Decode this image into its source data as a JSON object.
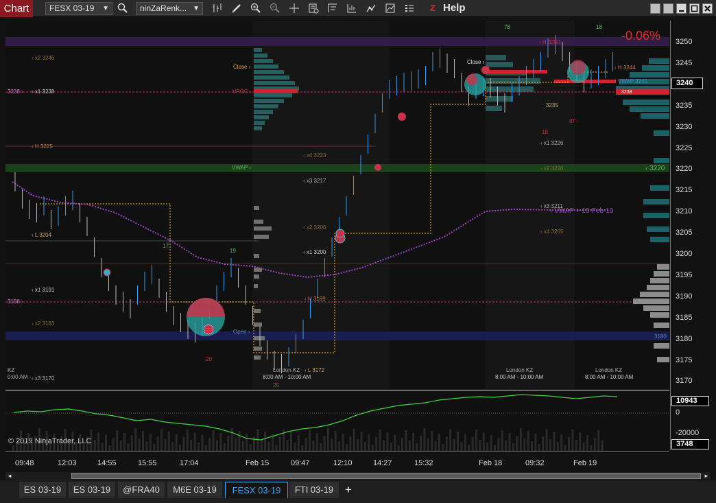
{
  "toolbar": {
    "chart_tab": "Chart",
    "instrument": "FESX 03-19",
    "bar_type": "ninZaRenk...",
    "help": "Help",
    "z_logo": "Z",
    "icons": [
      "search-icon",
      "bar-type-icon",
      "draw-icon",
      "zoom-in-icon",
      "zoom-out-icon",
      "crosshair-icon",
      "data-box-icon",
      "templates-icon",
      "chart-trader-icon",
      "strategy-icon",
      "indicators-icon",
      "properties-icon"
    ]
  },
  "window_controls": [
    "restore-icon",
    "tile-icon",
    "minimize-icon",
    "maximize-icon",
    "close-icon"
  ],
  "chart": {
    "percent_change": "-0.06%",
    "copyright": "© 2019 NinjaTrader, LLC",
    "price_axis": [
      "3250",
      "3245",
      "3240",
      "3235",
      "3230",
      "3225",
      "3220",
      "3215",
      "3210",
      "3205",
      "3200",
      "3195",
      "3190",
      "3185",
      "3180",
      "3175",
      "3170"
    ],
    "current_price": "3240",
    "sub_axis": [
      "0",
      "-20000"
    ],
    "sub_current": "10943",
    "sub_bottom": "3748",
    "time_axis": [
      "09:48",
      "12:03",
      "14:55",
      "15:55",
      "17:04",
      "Feb 15",
      "09:47",
      "12:10",
      "14:27",
      "15:32",
      "Feb 18",
      "09:32",
      "Feb 19"
    ],
    "annotations": {
      "x2_3246": "‹ x2 3246",
      "l3238": "3238 ›",
      "x1_3238": "‹ x1 3238",
      "h3225": "‹ H 3225",
      "l3204": "‹ L 3204",
      "l3188": "3188 ›",
      "x1_3191": "‹ x1 3191",
      "x2_3183": "‹ x2 3183",
      "x3_3170": "‹ x3 3170",
      "kz_left": "KZ",
      "am_left": "0:00 AM -",
      "close1": "Close ›",
      "vpoc": "VPOC ›",
      "vwap": "VWAP ›",
      "open": "Open ›",
      "x4_3223": "‹ x4 3223",
      "x3_3217": "‹ x3 3217",
      "x2_3206": "‹ x2 3206",
      "x1_3200": "‹ x1 3200",
      "h3189": "‹ H 3189",
      "l3172": "‹ L 3172",
      "london1": "London KZ",
      "time1": "8:00 AM - 10:00 AM",
      "close2": "Close ›",
      "h3250": "‹ H 3250",
      "h3244": "‹ H 3244",
      "x1_3226": "‹ x1 3226",
      "x2_3220": "‹ x2 3220",
      "x3_3211": "‹ x3 3211",
      "x4_3205": "‹ x4 3205",
      "vwap_label": "‹ VWAP + 15-Feb-19",
      "vwap_3241": "‹ VWAP 3241",
      "l3235": "3235",
      "bt": "BT ›",
      "r3238": "3238",
      "r3220": "‹ 3220",
      "r3180": "3180",
      "london2": "London KZ",
      "time2": "8:00 AM - 10:00 AM",
      "london3": "London KZ",
      "time3": "8:00 AM - 10:00 AM",
      "n17": "17",
      "n19": "19",
      "n20": "20",
      "n25": "25",
      "n78": "78",
      "n18a": "18",
      "n18b": "18"
    }
  },
  "scrollbar": {
    "left": "◄",
    "right": "►"
  },
  "tabs": [
    "ES 03-19",
    "ES 03-19",
    "@FRA40",
    "M6E 03-19",
    "FESX 03-19",
    "FTI 03-19"
  ],
  "active_tab": "FESX 03-19",
  "add_tab": "+"
}
